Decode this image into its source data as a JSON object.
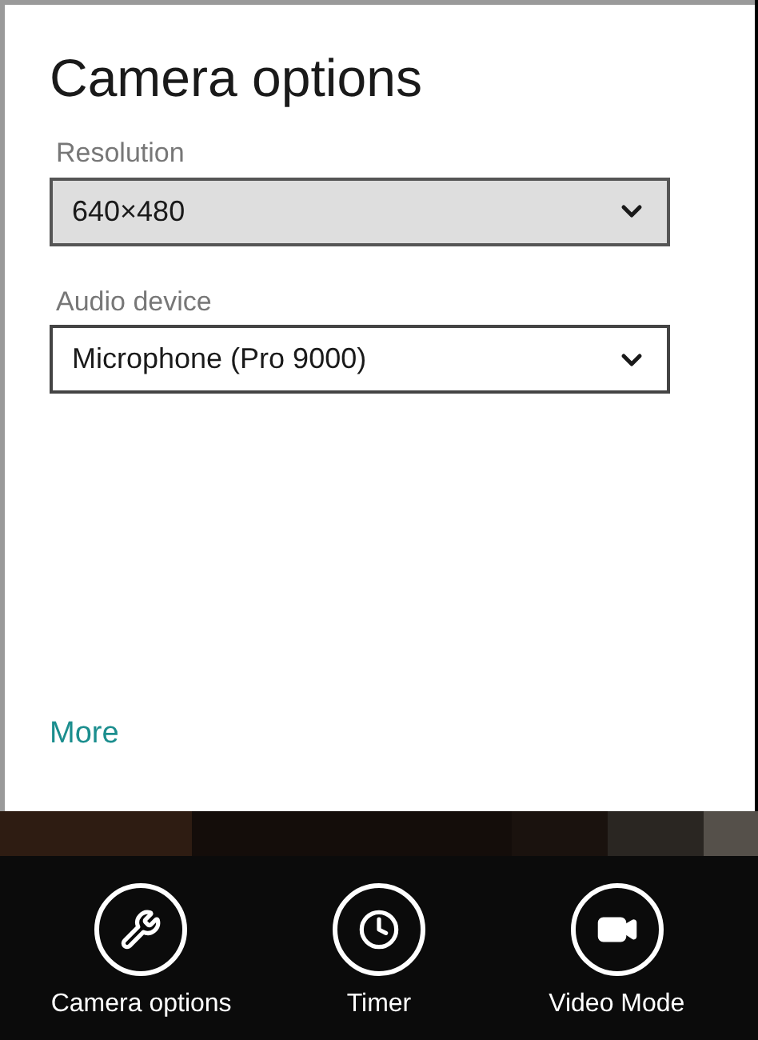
{
  "panel": {
    "title": "Camera options",
    "fields": [
      {
        "label": "Resolution",
        "value": "640×480",
        "focused": true
      },
      {
        "label": "Audio device",
        "value": "Microphone (Pro 9000)",
        "focused": false
      }
    ],
    "more_link": "More"
  },
  "app_bar": {
    "buttons": [
      {
        "kind": "wrench",
        "label": "Camera options"
      },
      {
        "kind": "clock",
        "label": "Timer"
      },
      {
        "kind": "video",
        "label": "Video Mode"
      }
    ]
  }
}
